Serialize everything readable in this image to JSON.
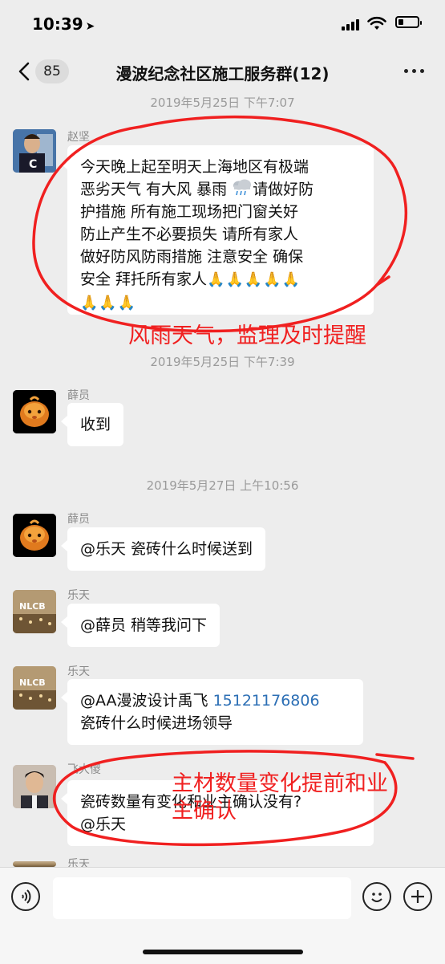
{
  "status_bar": {
    "time": "10:39",
    "location_icon": "location-arrow-icon",
    "battery_level": 0.25
  },
  "nav": {
    "back_badge": "85",
    "title": "漫波纪念社区施工服务群(12)"
  },
  "timestamps": [
    "2019年5月25日 下午7:07",
    "2019年5月25日 下午7:39",
    "2019年5月27日 上午10:56"
  ],
  "messages": [
    {
      "sender": "赵坚",
      "text": "今天晚上起至明天上海地区有极端\n恶劣天气 有大风 暴雨 ",
      "text_after_cloud": "请做好防\n护措施 所有施工现场把门窗关好\n防止产生不必要损失 请所有家人\n做好防风防雨措施 注意安全 确保\n安全 拜托所有家人",
      "emoji_1": "🙏🙏🙏🙏🙏",
      "emoji_2": "🙏🙏🙏"
    },
    {
      "sender": "薛员",
      "text": "收到"
    },
    {
      "sender": "薛员",
      "text": "@乐天 瓷砖什么时候送到"
    },
    {
      "sender": "乐天",
      "text": "@薛员 稍等我问下"
    },
    {
      "sender": "乐天",
      "text_prefix": "@AA漫波设计禹飞 ",
      "phone": "15121176806",
      "text_suffix": "瓷砖什么时候进场领导"
    },
    {
      "sender": "飞大傻",
      "text": "瓷砖数量有变化和业主确认没有?\n@乐天"
    },
    {
      "sender": "乐天"
    }
  ],
  "annotations": {
    "note_1": "风雨天气，监理及时提醒",
    "note_2_line1": "主材数量变化提前和业",
    "note_2_line2": "主确认",
    "color": "#f02020"
  },
  "input_bar": {
    "voice_icon": "voice-icon",
    "emoji_icon": "emoji-icon",
    "plus_icon": "plus-icon"
  }
}
